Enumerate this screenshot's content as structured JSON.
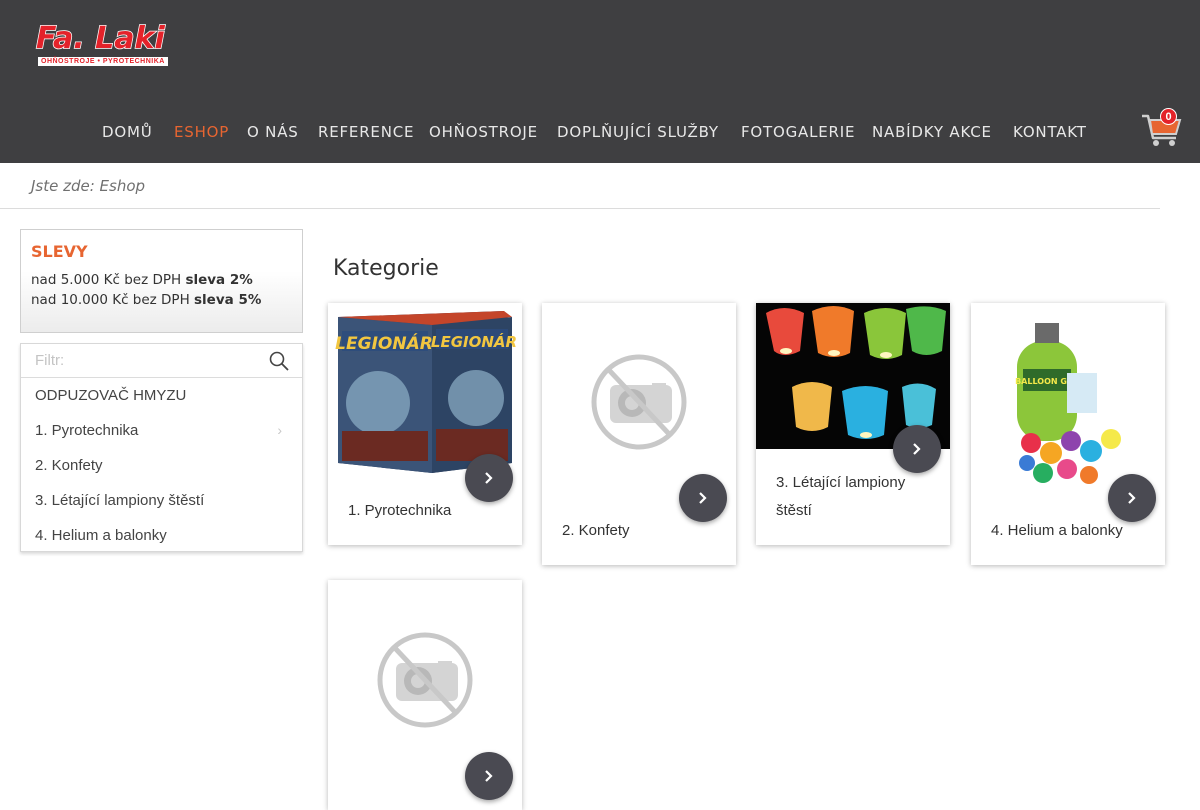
{
  "header": {
    "logo_text": "Fa. Laki",
    "logo_subtext": "OHŇOSTROJE • PYROTECHNIKA",
    "nav": [
      {
        "label": "DOMŮ",
        "active": false
      },
      {
        "label": "ESHOP",
        "active": true
      },
      {
        "label": "O NÁS",
        "active": false
      },
      {
        "label": "REFERENCE",
        "active": false
      },
      {
        "label": "OHŇOSTROJE",
        "active": false
      },
      {
        "label": "DOPLŇUJÍCÍ SLUŽBY",
        "active": false
      },
      {
        "label": "FOTOGALERIE",
        "active": false
      },
      {
        "label": "NABÍDKY AKCE",
        "active": false
      },
      {
        "label": "KONTAKT",
        "active": false
      }
    ],
    "cart_count": "0"
  },
  "breadcrumb": "Jste zde: Eshop",
  "sidebar": {
    "slevy_title": "SLEVY",
    "slevy_lines": [
      {
        "prefix": "nad 5.000 Kč bez DPH ",
        "bold": "sleva 2%"
      },
      {
        "prefix": "nad 10.000 Kč bez DPH ",
        "bold": "sleva 5%"
      }
    ],
    "filter_placeholder": "Filtr:",
    "categories": [
      {
        "label": "ODPUZOVAČ HMYZU",
        "has_children": false
      },
      {
        "label": "1. Pyrotechnika",
        "has_children": true
      },
      {
        "label": "2. Konfety",
        "has_children": false
      },
      {
        "label": "3. Létající lampiony štěstí",
        "has_children": false
      },
      {
        "label": "4. Helium a balonky",
        "has_children": false
      }
    ]
  },
  "main": {
    "heading": "Kategorie",
    "cards": [
      {
        "label": "1. Pyrotechnika",
        "image": "fireworks-box-legionar",
        "image_text": "LEGIONÁR"
      },
      {
        "label": "2. Konfety",
        "image": "no-image-placeholder"
      },
      {
        "label": "3. Létající lampiony štěstí",
        "image": "flying-lanterns"
      },
      {
        "label": "4. Helium a balonky",
        "image": "helium-tank-balloons",
        "image_text": "BALLOON GAZ"
      },
      {
        "label": "",
        "image": "no-image-placeholder"
      }
    ]
  },
  "colors": {
    "header_bg": "#3f3f41",
    "accent": "#e76531",
    "brand_red": "#e4222a",
    "button_dark": "#4a4a52"
  }
}
